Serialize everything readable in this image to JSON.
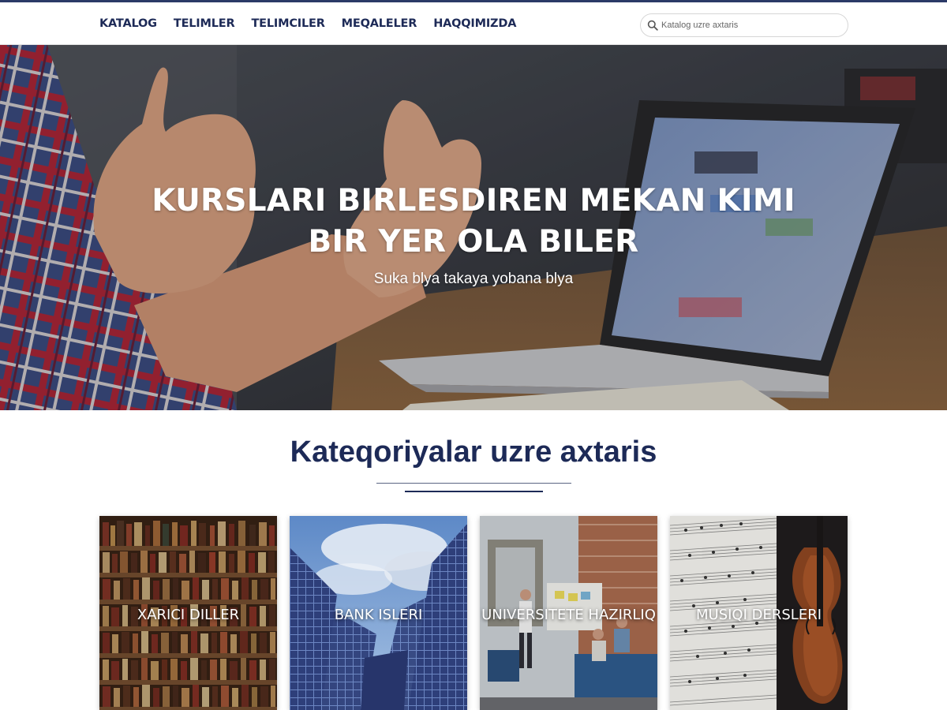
{
  "nav": {
    "items": [
      {
        "label": "KATALOG"
      },
      {
        "label": "TELIMLER"
      },
      {
        "label": "TELIMCILER"
      },
      {
        "label": "MEQALELER"
      },
      {
        "label": "HAQQIMIZDA"
      }
    ]
  },
  "search": {
    "placeholder": "Katalog uzre axtaris",
    "value": ""
  },
  "hero": {
    "title": "KURSLARI BIRLESDIREN MEKAN KIMI BIR YER OLA BILER",
    "subtitle": "Suka blya takaya yobana blya"
  },
  "categories": {
    "title": "Kateqoriyalar uzre axtaris",
    "items": [
      {
        "label": "XARICI DILLER"
      },
      {
        "label": "BANK ISLERI"
      },
      {
        "label": "UNIVERSITETE HAZIRLIQ"
      },
      {
        "label": "MUSIQI DERSLERI"
      }
    ]
  },
  "colors": {
    "brand": "#1d2a57",
    "accent": "#2b3a67",
    "background": "#ffffff"
  },
  "icons": {
    "search": "search-icon"
  }
}
